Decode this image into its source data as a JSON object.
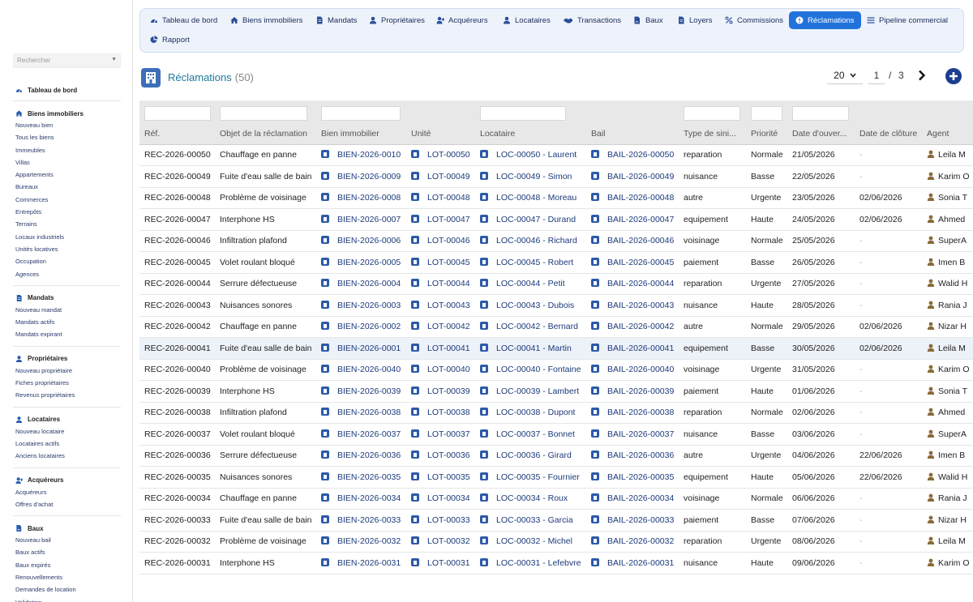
{
  "search": {
    "placeholder": "Rechercher"
  },
  "sidebar": {
    "sections": [
      {
        "title": "Tableau de bord",
        "icon": "dashboard-icon",
        "items": []
      },
      {
        "title": "Biens immobiliers",
        "icon": "home-icon",
        "items": [
          "Nouveau bien",
          "Tous les biens",
          "Immeubles",
          "Villas",
          "Appartements",
          "Bureaux",
          "Commerces",
          "Entrepôts",
          "Terrains",
          "Locaux industriels",
          "Unités locatives",
          "Occupation",
          "Agences"
        ]
      },
      {
        "title": "Mandats",
        "icon": "document-icon",
        "items": [
          "Nouveau mandat",
          "Mandats actifs",
          "Mandats expirant"
        ]
      },
      {
        "title": "Propriétaires",
        "icon": "user-icon",
        "items": [
          "Nouveau propriétaire",
          "Fiches propriétaires",
          "Revenus propriétaires"
        ]
      },
      {
        "title": "Locataires",
        "icon": "user-icon",
        "items": [
          "Nouveau locataire",
          "Locataires actifs",
          "Anciens locataires"
        ]
      },
      {
        "title": "Acquéreurs",
        "icon": "user-plus-icon",
        "items": [
          "Acquéreurs",
          "Offres d'achat"
        ]
      },
      {
        "title": "Baux",
        "icon": "file-signature-icon",
        "items": [
          "Nouveau bail",
          "Baux actifs",
          "Baux expirés",
          "Renouvellements",
          "Demandes de location",
          "Validation"
        ]
      }
    ]
  },
  "nav": {
    "tabs": [
      {
        "label": "Tableau de bord",
        "icon": "dashboard-icon",
        "active": false
      },
      {
        "label": "Biens immobiliers",
        "icon": "home-icon",
        "active": false
      },
      {
        "label": "Mandats",
        "icon": "document-icon",
        "active": false
      },
      {
        "label": "Propriétaires",
        "icon": "user-icon",
        "active": false
      },
      {
        "label": "Acquéreurs",
        "icon": "user-plus-icon",
        "active": false
      },
      {
        "label": "Locataires",
        "icon": "user-icon",
        "active": false
      },
      {
        "label": "Transactions",
        "icon": "handshake-icon",
        "active": false
      },
      {
        "label": "Baux",
        "icon": "file-signature-icon",
        "active": false
      },
      {
        "label": "Loyers",
        "icon": "document-icon",
        "active": false
      },
      {
        "label": "Commissions",
        "icon": "percent-icon",
        "active": false
      },
      {
        "label": "Réclamations",
        "icon": "alert-circle-icon",
        "active": true
      },
      {
        "label": "Pipeline commercial",
        "icon": "list-icon",
        "active": false
      },
      {
        "label": "Rapport",
        "icon": "pie-chart-icon",
        "active": false
      }
    ]
  },
  "page": {
    "title": "Réclamations",
    "count": "(50)",
    "per_page": "20",
    "current_page": "1",
    "separator": "/",
    "total_pages": "3"
  },
  "colors": {
    "accent": "#2272dc",
    "brand_dark": "#1b3d8f",
    "title": "#1f7a9c",
    "link": "#1c3a7a"
  },
  "table": {
    "columns": [
      "Réf.",
      "Objet de la réclamation",
      "Bien immobilier",
      "Unité",
      "Locataire",
      "Bail",
      "Type de sini...",
      "Priorité",
      "Date d'ouver...",
      "Date de clôture",
      "Agent"
    ],
    "rows": [
      [
        "REC-2026-00050",
        "Chauffage en panne",
        "BIEN-2026-0010",
        "LOT-00050",
        "LOC-00050 - Laurent",
        "BAIL-2026-00050",
        "reparation",
        "Normale",
        "21/05/2026",
        "-",
        "Leila M"
      ],
      [
        "REC-2026-00049",
        "Fuite d'eau salle de bain",
        "BIEN-2026-0009",
        "LOT-00049",
        "LOC-00049 - Simon",
        "BAIL-2026-00049",
        "nuisance",
        "Basse",
        "22/05/2026",
        "-",
        "Karim O"
      ],
      [
        "REC-2026-00048",
        "Problème de voisinage",
        "BIEN-2026-0008",
        "LOT-00048",
        "LOC-00048 - Moreau",
        "BAIL-2026-00048",
        "autre",
        "Urgente",
        "23/05/2026",
        "02/06/2026",
        "Sonia T"
      ],
      [
        "REC-2026-00047",
        "Interphone HS",
        "BIEN-2026-0007",
        "LOT-00047",
        "LOC-00047 - Durand",
        "BAIL-2026-00047",
        "equipement",
        "Haute",
        "24/05/2026",
        "02/06/2026",
        "Ahmed"
      ],
      [
        "REC-2026-00046",
        "Infiltration plafond",
        "BIEN-2026-0006",
        "LOT-00046",
        "LOC-00046 - Richard",
        "BAIL-2026-00046",
        "voisinage",
        "Normale",
        "25/05/2026",
        "-",
        "SuperA"
      ],
      [
        "REC-2026-00045",
        "Volet roulant bloqué",
        "BIEN-2026-0005",
        "LOT-00045",
        "LOC-00045 - Robert",
        "BAIL-2026-00045",
        "paiement",
        "Basse",
        "26/05/2026",
        "-",
        "Imen B"
      ],
      [
        "REC-2026-00044",
        "Serrure défectueuse",
        "BIEN-2026-0004",
        "LOT-00044",
        "LOC-00044 - Petit",
        "BAIL-2026-00044",
        "reparation",
        "Urgente",
        "27/05/2026",
        "-",
        "Walid H"
      ],
      [
        "REC-2026-00043",
        "Nuisances sonores",
        "BIEN-2026-0003",
        "LOT-00043",
        "LOC-00043 - Dubois",
        "BAIL-2026-00043",
        "nuisance",
        "Haute",
        "28/05/2026",
        "-",
        "Rania J"
      ],
      [
        "REC-2026-00042",
        "Chauffage en panne",
        "BIEN-2026-0002",
        "LOT-00042",
        "LOC-00042 - Bernard",
        "BAIL-2026-00042",
        "autre",
        "Normale",
        "29/05/2026",
        "02/06/2026",
        "Nizar H"
      ],
      [
        "REC-2026-00041",
        "Fuite d'eau salle de bain",
        "BIEN-2026-0001",
        "LOT-00041",
        "LOC-00041 - Martin",
        "BAIL-2026-00041",
        "equipement",
        "Basse",
        "30/05/2026",
        "02/06/2026",
        "Leila M"
      ],
      [
        "REC-2026-00040",
        "Problème de voisinage",
        "BIEN-2026-0040",
        "LOT-00040",
        "LOC-00040 - Fontaine",
        "BAIL-2026-00040",
        "voisinage",
        "Urgente",
        "31/05/2026",
        "-",
        "Karim O"
      ],
      [
        "REC-2026-00039",
        "Interphone HS",
        "BIEN-2026-0039",
        "LOT-00039",
        "LOC-00039 - Lambert",
        "BAIL-2026-00039",
        "paiement",
        "Haute",
        "01/06/2026",
        "-",
        "Sonia T"
      ],
      [
        "REC-2026-00038",
        "Infiltration plafond",
        "BIEN-2026-0038",
        "LOT-00038",
        "LOC-00038 - Dupont",
        "BAIL-2026-00038",
        "reparation",
        "Normale",
        "02/06/2026",
        "-",
        "Ahmed"
      ],
      [
        "REC-2026-00037",
        "Volet roulant bloqué",
        "BIEN-2026-0037",
        "LOT-00037",
        "LOC-00037 - Bonnet",
        "BAIL-2026-00037",
        "nuisance",
        "Basse",
        "03/06/2026",
        "-",
        "SuperA"
      ],
      [
        "REC-2026-00036",
        "Serrure défectueuse",
        "BIEN-2026-0036",
        "LOT-00036",
        "LOC-00036 - Girard",
        "BAIL-2026-00036",
        "autre",
        "Urgente",
        "04/06/2026",
        "22/06/2026",
        "Imen B"
      ],
      [
        "REC-2026-00035",
        "Nuisances sonores",
        "BIEN-2026-0035",
        "LOT-00035",
        "LOC-00035 - Fournier",
        "BAIL-2026-00035",
        "equipement",
        "Haute",
        "05/06/2026",
        "22/06/2026",
        "Walid H"
      ],
      [
        "REC-2026-00034",
        "Chauffage en panne",
        "BIEN-2026-0034",
        "LOT-00034",
        "LOC-00034 - Roux",
        "BAIL-2026-00034",
        "voisinage",
        "Normale",
        "06/06/2026",
        "-",
        "Rania J"
      ],
      [
        "REC-2026-00033",
        "Fuite d'eau salle de bain",
        "BIEN-2026-0033",
        "LOT-00033",
        "LOC-00033 - Garcia",
        "BAIL-2026-00033",
        "paiement",
        "Basse",
        "07/06/2026",
        "-",
        "Nizar H"
      ],
      [
        "REC-2026-00032",
        "Problème de voisinage",
        "BIEN-2026-0032",
        "LOT-00032",
        "LOC-00032 - Michel",
        "BAIL-2026-00032",
        "reparation",
        "Urgente",
        "08/06/2026",
        "-",
        "Leila M"
      ],
      [
        "REC-2026-00031",
        "Interphone HS",
        "BIEN-2026-0031",
        "LOT-00031",
        "LOC-00031 - Lefebvre",
        "BAIL-2026-00031",
        "nuisance",
        "Haute",
        "09/06/2026",
        "-",
        "Karim O"
      ]
    ]
  }
}
